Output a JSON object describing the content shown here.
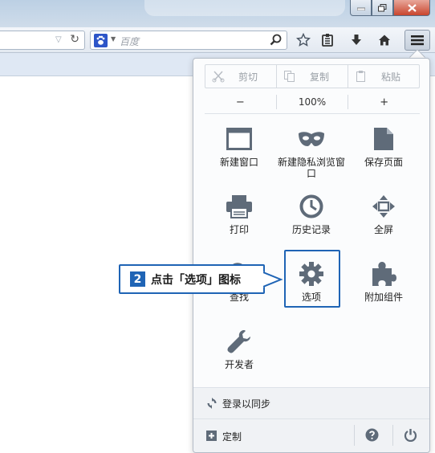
{
  "searchbar": {
    "placeholder": "百度"
  },
  "menu_panel": {
    "edit": {
      "cut": "剪切",
      "copy": "复制",
      "paste": "粘贴"
    },
    "zoom": {
      "out": "−",
      "level": "100%",
      "in": "+"
    },
    "items": [
      {
        "label": "新建窗口",
        "icon": "new-window-icon"
      },
      {
        "label": "新建隐私浏览窗口",
        "icon": "private-mask-icon"
      },
      {
        "label": "保存页面",
        "icon": "save-page-icon"
      },
      {
        "label": "打印",
        "icon": "printer-icon"
      },
      {
        "label": "历史记录",
        "icon": "clock-icon"
      },
      {
        "label": "全屏",
        "icon": "fullscreen-icon"
      },
      {
        "label": "查找",
        "icon": "search-icon"
      },
      {
        "label": "选项",
        "icon": "gear-icon"
      },
      {
        "label": "附加组件",
        "icon": "puzzle-icon"
      },
      {
        "label": "开发者",
        "icon": "wrench-icon"
      }
    ],
    "sync": "登录以同步",
    "customize": "定制"
  },
  "callout": {
    "step": "2",
    "text": "点击「选项」图标"
  },
  "colors": {
    "accent": "#1f64b5",
    "icon_gray": "#5f6b79"
  }
}
